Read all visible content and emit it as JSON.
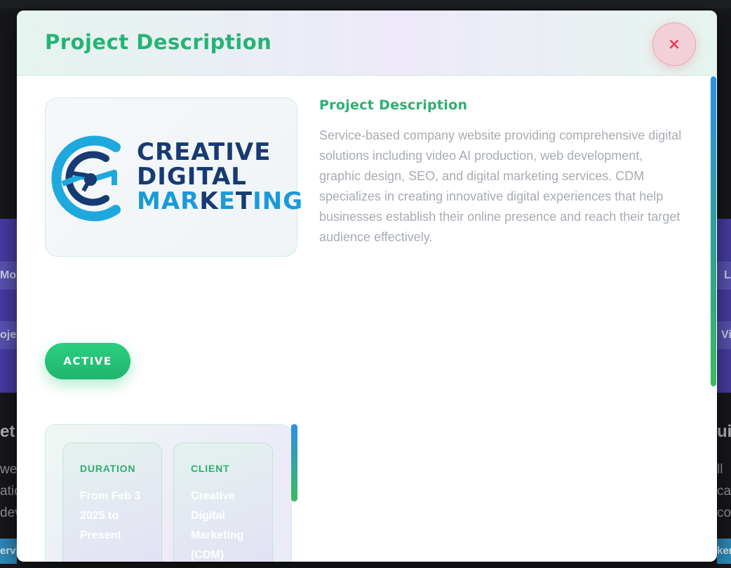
{
  "background": {
    "left_rows": [
      "More",
      "oject"
    ],
    "right_rows": [
      "L",
      "Vi"
    ],
    "left_title": "et",
    "right_title": "ui",
    "left_lines": [
      "web",
      "ation",
      "devel"
    ],
    "right_lines": [
      "ll",
      "ca",
      "co"
    ],
    "left_pill": "ervi",
    "right_pill": "ker"
  },
  "modal": {
    "title": "Project Description",
    "close_label": "×",
    "logo": {
      "line1": "CREATIVE",
      "line2": "DIGITAL",
      "line3_part1": "MAR",
      "line3_part2": "K",
      "line3_part3": "E",
      "line3_part4": "T",
      "line3_part5": "ING"
    },
    "description_heading": "Project Description",
    "description_text": "Service-based company website providing comprehensive digital solutions including video AI production, web development, graphic design, SEO, and digital marketing services. CDM specializes in creating innovative digital experiences that help businesses establish their online presence and reach their target audience effectively.",
    "status": "ACTIVE",
    "details": [
      {
        "label": "DURATION",
        "value": "From Feb 3 2025 to Present"
      },
      {
        "label": "CLIENT",
        "value": "Creative Digital Marketing (CDM)"
      }
    ]
  },
  "colors": {
    "accent_green": "#22b574",
    "close_red": "#ee3a5a",
    "logo_navy": "#163b72",
    "logo_blue": "#1a9ad8"
  }
}
